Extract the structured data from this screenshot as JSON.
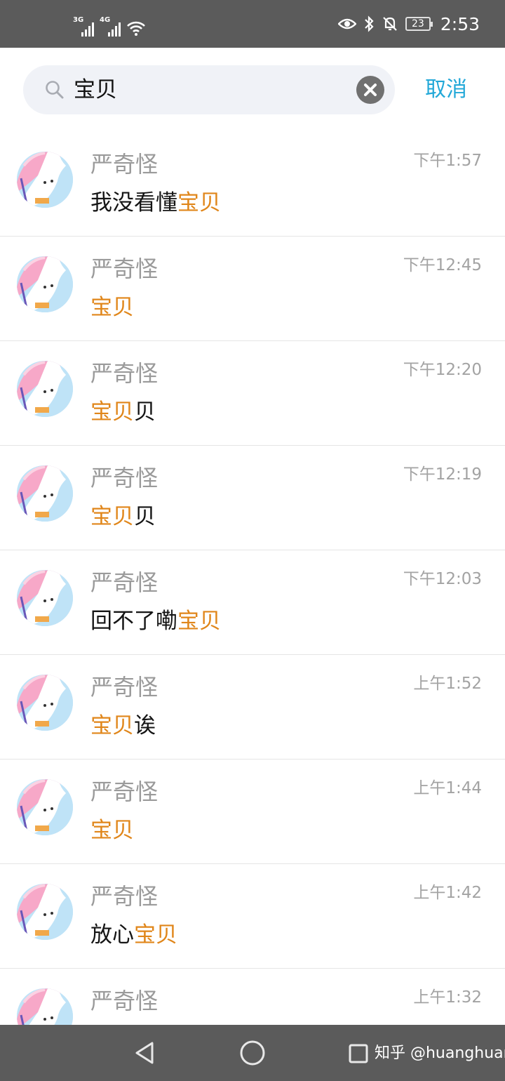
{
  "status_bar": {
    "network_1": "3G",
    "network_2": "4G",
    "icons": [
      "signal-icon",
      "signal-icon",
      "wifi-icon",
      "eye-icon",
      "bluetooth-icon",
      "mute-icon",
      "battery-icon"
    ],
    "battery_level": "23",
    "time": "2:53"
  },
  "search": {
    "query": "宝贝",
    "cancel_label": "取消"
  },
  "results": [
    {
      "name": "严奇怪",
      "time": "下午1:57",
      "pre": "我没看懂",
      "hl": "宝贝",
      "post": ""
    },
    {
      "name": "严奇怪",
      "time": "下午12:45",
      "pre": "",
      "hl": "宝贝",
      "post": ""
    },
    {
      "name": "严奇怪",
      "time": "下午12:20",
      "pre": "",
      "hl": "宝贝",
      "post": "贝"
    },
    {
      "name": "严奇怪",
      "time": "下午12:19",
      "pre": "",
      "hl": "宝贝",
      "post": "贝"
    },
    {
      "name": "严奇怪",
      "time": "下午12:03",
      "pre": "回不了嘞",
      "hl": "宝贝",
      "post": ""
    },
    {
      "name": "严奇怪",
      "time": "上午1:52",
      "pre": "",
      "hl": "宝贝",
      "post": "诶"
    },
    {
      "name": "严奇怪",
      "time": "上午1:44",
      "pre": "",
      "hl": "宝贝",
      "post": ""
    },
    {
      "name": "严奇怪",
      "time": "上午1:42",
      "pre": "放心",
      "hl": "宝贝",
      "post": ""
    },
    {
      "name": "严奇怪",
      "time": "上午1:32",
      "pre": "",
      "hl": "",
      "post": ""
    }
  ],
  "nav": {
    "watermark": "知乎 @huanghuang"
  },
  "colors": {
    "highlight": "#e0861a",
    "cancel": "#22a8d8",
    "bar": "#5b5b5b"
  }
}
